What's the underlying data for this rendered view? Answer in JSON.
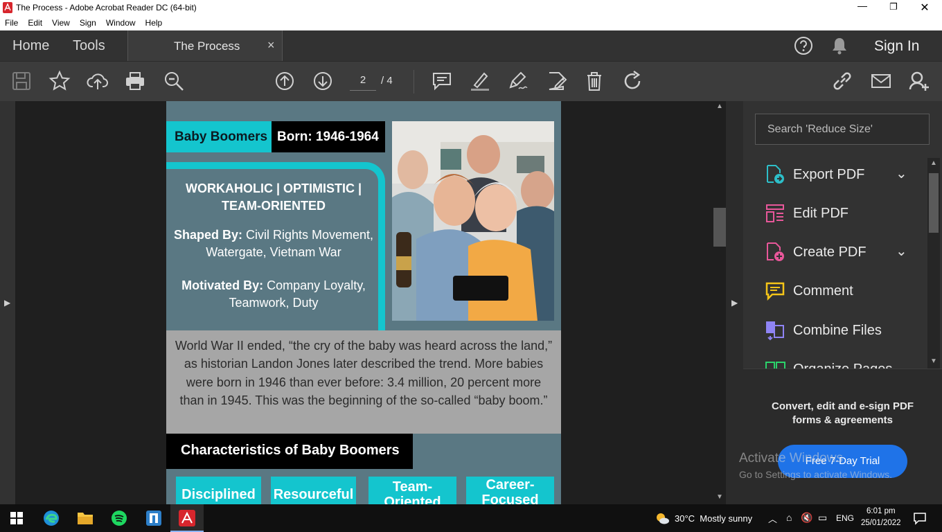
{
  "window": {
    "title": "The Process - Adobe Acrobat Reader DC (64-bit)"
  },
  "menu": [
    "File",
    "Edit",
    "View",
    "Sign",
    "Window",
    "Help"
  ],
  "tabs": {
    "home": "Home",
    "tools": "Tools",
    "doc": "The Process",
    "close": "×"
  },
  "header": {
    "sign_in": "Sign In"
  },
  "toolbar": {
    "page_current": "2",
    "page_total": "/ 4"
  },
  "page": {
    "label_generation": "Baby Boomers",
    "label_born": "Born: 1946-1964",
    "traits": "WORKAHOLIC | OPTIMISTIC | TEAM-ORIENTED",
    "shaped_label": "Shaped By:",
    "shaped_text": " Civil Rights Movement, Watergate, Vietnam War",
    "motivated_label": "Motivated By:",
    "motivated_text": " Company Loyalty, Teamwork, Duty",
    "history": "World War II ended, “the cry of the baby was heard across the land,” as historian Landon Jones later described the trend. More babies were born in 1946 than ever before: 3.4 million, 20 percent more than in 1945. This was the beginning of the so-called “baby boom.”",
    "characteristics_heading": "Characteristics of Baby Boomers",
    "characteristics": [
      "Disciplined",
      "Resourceful",
      "Team-Oriented",
      "Career-Focused"
    ]
  },
  "right_panel": {
    "search_placeholder": "Search 'Reduce Size'",
    "tools": [
      {
        "label": "Export PDF",
        "icon": "export-pdf-icon",
        "color": "#2dbfc9",
        "chevron": "down"
      },
      {
        "label": "Edit PDF",
        "icon": "edit-pdf-icon",
        "color": "#e8579a",
        "chevron": ""
      },
      {
        "label": "Create PDF",
        "icon": "create-pdf-icon",
        "color": "#e8579a",
        "chevron": "down"
      },
      {
        "label": "Comment",
        "icon": "comment-icon",
        "color": "#f5c518",
        "chevron": ""
      },
      {
        "label": "Combine Files",
        "icon": "combine-files-icon",
        "color": "#8f84f5",
        "chevron": ""
      },
      {
        "label": "Organize Pages",
        "icon": "organize-pages-icon",
        "color": "#2bd46b",
        "chevron": "up"
      }
    ],
    "promo": "Convert, edit and e-sign PDF forms & agreements",
    "trial_button": "Free 7-Day Trial"
  },
  "watermark": {
    "line1": "Activate Windows",
    "line2": "Go to Settings to activate Windows."
  },
  "taskbar": {
    "weather": "30°C  Mostly sunny",
    "lang": "ENG",
    "time": "6:01 pm",
    "date": "25/01/2022"
  }
}
